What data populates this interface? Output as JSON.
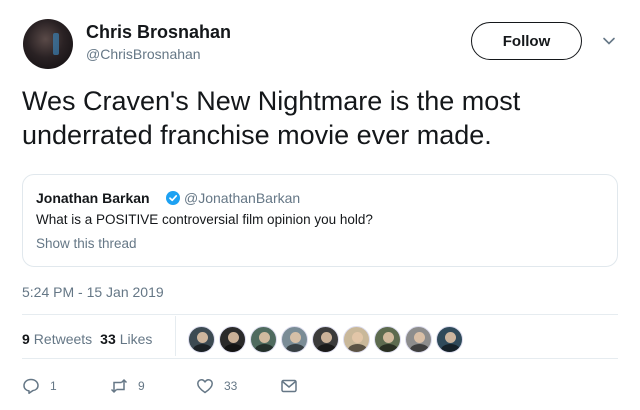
{
  "author": {
    "name": "Chris Brosnahan",
    "handle": "@ChrisBrosnahan"
  },
  "follow_label": "Follow",
  "tweet_text": "Wes Craven's New Nightmare is the most underrated franchise movie ever made.",
  "quoted": {
    "name": "Jonathan Barkan",
    "handle": "@JonathanBarkan",
    "text": "What is a POSITIVE controversial film opinion you hold?",
    "show_thread": "Show this thread"
  },
  "timestamp": "5:24 PM - 15 Jan 2019",
  "stats": {
    "retweets_count": "9",
    "retweets_label": "Retweets",
    "likes_count": "33",
    "likes_label": "Likes"
  },
  "likers": [
    {
      "bg": "#3c4a52"
    },
    {
      "bg": "#2a2a2a"
    },
    {
      "bg": "#4f6b5f"
    },
    {
      "bg": "#7a8c96"
    },
    {
      "bg": "#3b3b3b"
    },
    {
      "bg": "#c9b89a"
    },
    {
      "bg": "#5d6b4f"
    },
    {
      "bg": "#8d8d8d"
    },
    {
      "bg": "#2f4a5a"
    }
  ],
  "actions": {
    "reply_count": "1",
    "retweet_count": "9",
    "like_count": "33"
  },
  "colors": {
    "verified": "#1da1f2",
    "muted": "#657786",
    "text": "#14171a"
  }
}
